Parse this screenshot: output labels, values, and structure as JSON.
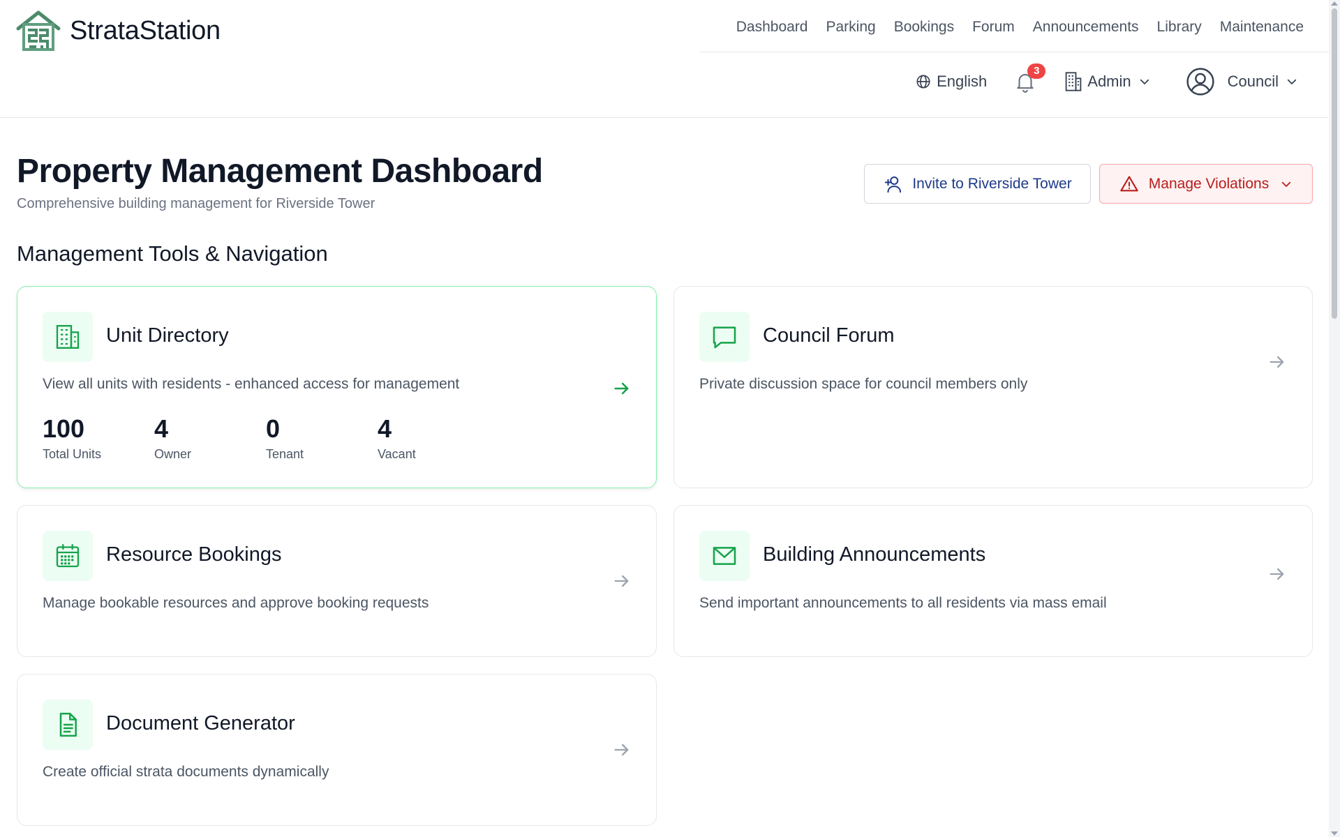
{
  "app": {
    "name": "StrataStation"
  },
  "nav": {
    "items": [
      "Dashboard",
      "Parking",
      "Bookings",
      "Forum",
      "Announcements",
      "Library",
      "Maintenance"
    ]
  },
  "toolbar": {
    "language": "English",
    "notifications_count": "3",
    "building_role": "Admin",
    "user_role": "Council"
  },
  "header": {
    "title": "Property Management Dashboard",
    "subtitle": "Comprehensive building management for Riverside Tower",
    "invite_label": "Invite to Riverside Tower",
    "violations_label": "Manage Violations"
  },
  "section": {
    "title": "Management Tools & Navigation"
  },
  "cards": {
    "unit_directory": {
      "title": "Unit Directory",
      "description": "View all units with residents - enhanced access for management",
      "stats": [
        {
          "value": "100",
          "label": "Total Units"
        },
        {
          "value": "4",
          "label": "Owner"
        },
        {
          "value": "0",
          "label": "Tenant"
        },
        {
          "value": "4",
          "label": "Vacant"
        }
      ]
    },
    "council_forum": {
      "title": "Council Forum",
      "description": "Private discussion space for council members only"
    },
    "resource_bookings": {
      "title": "Resource Bookings",
      "description": "Manage bookable resources and approve booking requests"
    },
    "building_announcements": {
      "title": "Building Announcements",
      "description": "Send important announcements to all residents via mass email"
    },
    "document_generator": {
      "title": "Document Generator",
      "description": "Create official strata documents dynamically"
    }
  },
  "colors": {
    "brand_green": "#16a34a",
    "icon_bg": "#ecfdf3",
    "danger": "#b91c1c",
    "danger_bg": "#fef2f2",
    "badge": "#ef4444",
    "invite_text": "#1e3a8a"
  }
}
